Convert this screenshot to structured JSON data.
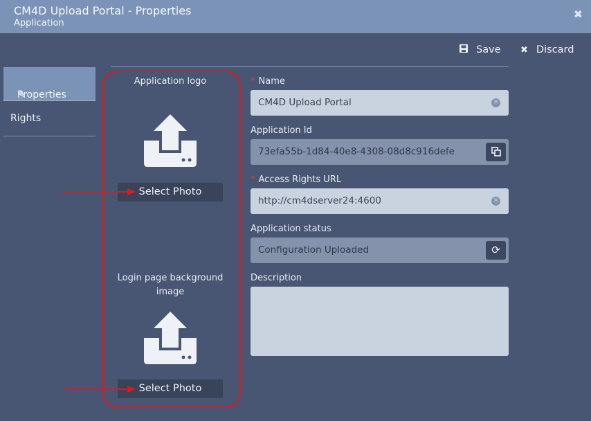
{
  "window": {
    "title": "CM4D Upload Portal - Properties",
    "subtitle": "Application",
    "close_icon": "close-x-icon"
  },
  "toolbar": {
    "save_label": "Save",
    "save_icon": "floppy-disk-icon",
    "discard_label": "Discard",
    "discard_icon": "x-icon"
  },
  "sidebar": {
    "items": [
      {
        "label": "Properties",
        "icon": "pencil-icon",
        "active": true
      },
      {
        "label": "Rights",
        "active": false
      }
    ]
  },
  "images": {
    "logo": {
      "label": "Application logo",
      "button": "Select Photo",
      "icon": "upload-tray-icon"
    },
    "background": {
      "label_line1": "Login page background",
      "label_line2": "image",
      "button": "Select Photo",
      "icon": "upload-tray-icon"
    }
  },
  "form": {
    "name": {
      "label": "Name",
      "required": true,
      "value": "CM4D Upload Portal"
    },
    "app_id": {
      "label": "Application Id",
      "value": "73efa55b-1d84-40e8-4308-08d8c916defe",
      "action_icon": "copy-icon"
    },
    "access_url": {
      "label": "Access Rights URL",
      "required": true,
      "value": "http://cm4dserver24:4600"
    },
    "status": {
      "label": "Application status",
      "value": "Configuration Uploaded",
      "action_icon": "refresh-icon"
    },
    "description": {
      "label": "Description",
      "value": ""
    }
  },
  "colors": {
    "background": "#485573",
    "titlebar": "#7b93b6",
    "highlight": "#e01818",
    "required": "#e53935"
  }
}
